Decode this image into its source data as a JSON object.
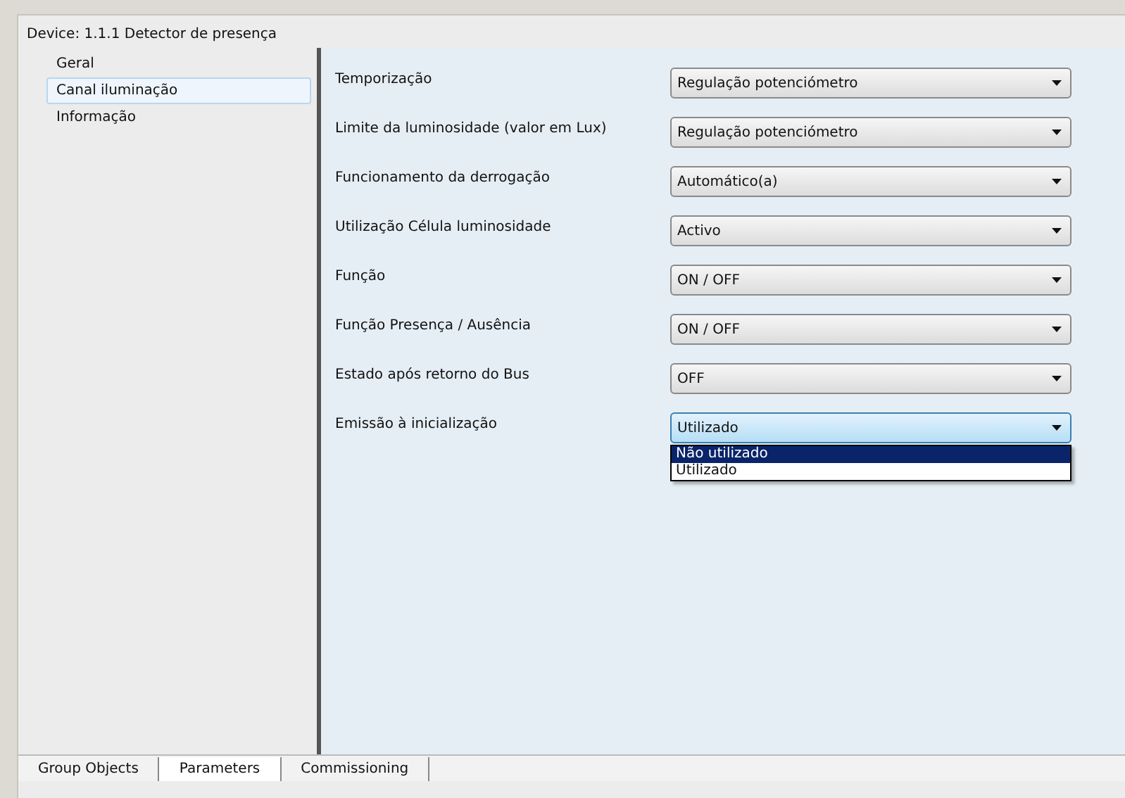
{
  "window": {
    "title": "Device: 1.1.1  Detector de presença"
  },
  "sidebar": {
    "items": [
      {
        "label": "Geral",
        "selected": false
      },
      {
        "label": "Canal iluminação",
        "selected": true
      },
      {
        "label": "Informação",
        "selected": false
      }
    ]
  },
  "parameters": [
    {
      "label": "Temporização",
      "value": "Regulação potenciómetro",
      "expanded": false
    },
    {
      "label": "Limite da luminosidade (valor em Lux)",
      "value": "Regulação potenciómetro",
      "expanded": false
    },
    {
      "label": "Funcionamento da derrogação",
      "value": "Automático(a)",
      "expanded": false
    },
    {
      "label": "Utilização Célula luminosidade",
      "value": "Activo",
      "expanded": false
    },
    {
      "label": "Função",
      "value": "ON / OFF",
      "expanded": false
    },
    {
      "label": "Função Presença / Ausência",
      "value": "ON / OFF",
      "expanded": false
    },
    {
      "label": "Estado após retorno do Bus",
      "value": "OFF",
      "expanded": false
    },
    {
      "label": "Emissão à inicialização",
      "value": "Utilizado",
      "expanded": true,
      "options": [
        {
          "label": "Não utilizado",
          "highlighted": true
        },
        {
          "label": "Utilizado",
          "highlighted": false
        }
      ]
    }
  ],
  "tabs": [
    {
      "label": "Group Objects",
      "selected": false
    },
    {
      "label": "Parameters",
      "selected": true
    },
    {
      "label": "Commissioning",
      "selected": false
    }
  ]
}
